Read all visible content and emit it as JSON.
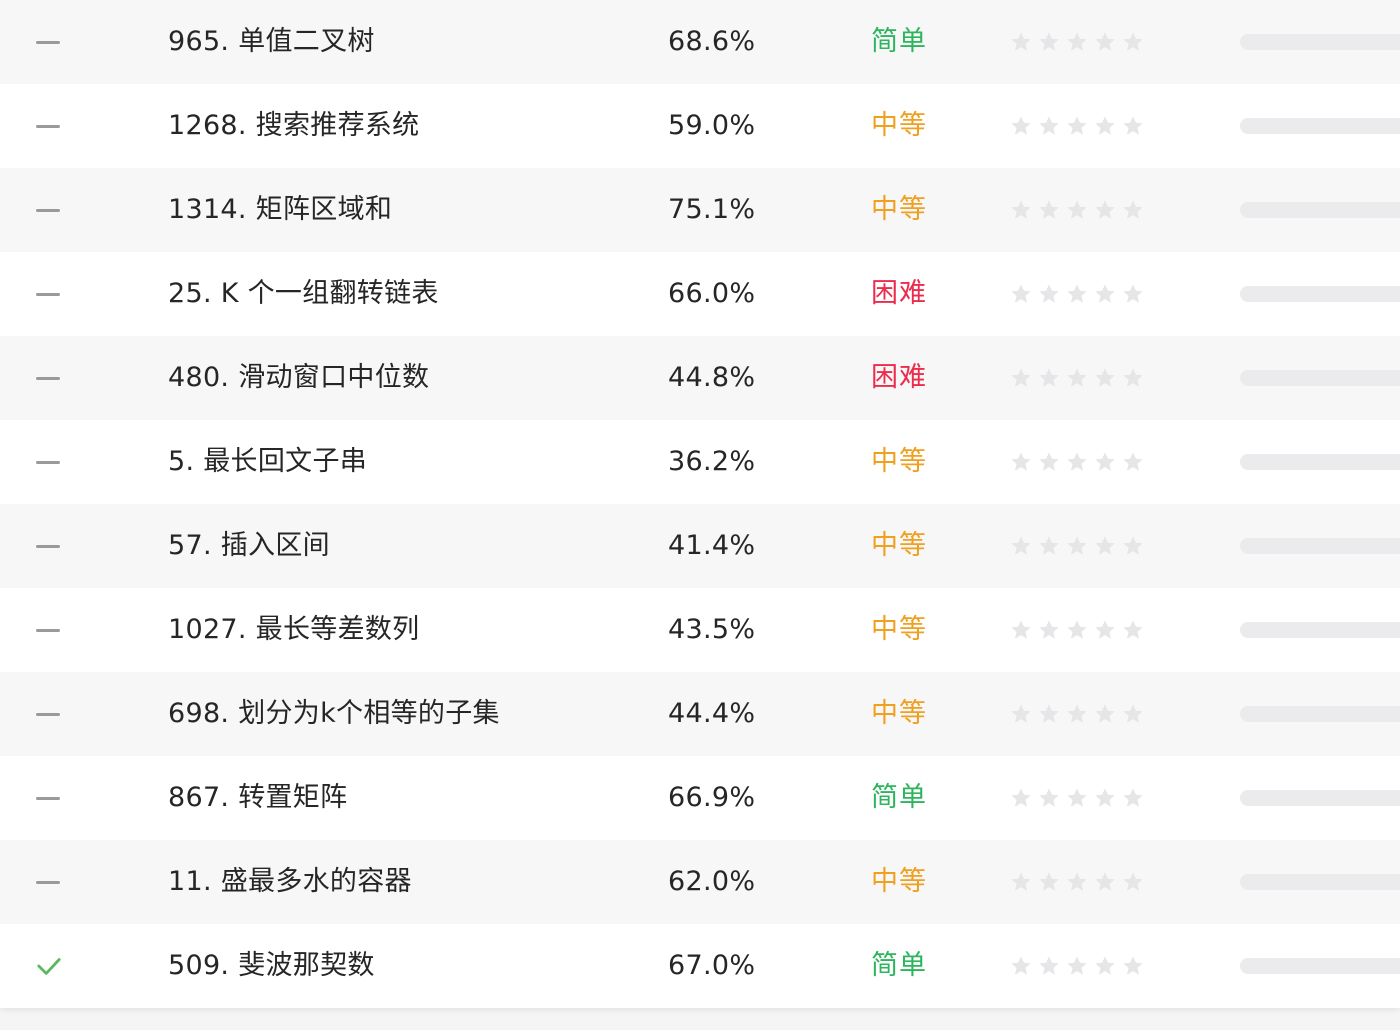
{
  "problems": [
    {
      "status": "none",
      "title": "965. 单值二叉树",
      "rate": "68.6%",
      "difficulty": "简单",
      "difficulty_color": "#2db55d",
      "frequency": 0
    },
    {
      "status": "none",
      "title": "1268. 搜索推荐系统",
      "rate": "59.0%",
      "difficulty": "中等",
      "difficulty_color": "#f0a020",
      "frequency": 0
    },
    {
      "status": "none",
      "title": "1314. 矩阵区域和",
      "rate": "75.1%",
      "difficulty": "中等",
      "difficulty_color": "#f0a020",
      "frequency": 0
    },
    {
      "status": "none",
      "title": "25. K 个一组翻转链表",
      "rate": "66.0%",
      "difficulty": "困难",
      "difficulty_color": "#ec2c4c",
      "frequency": 0
    },
    {
      "status": "none",
      "title": "480. 滑动窗口中位数",
      "rate": "44.8%",
      "difficulty": "困难",
      "difficulty_color": "#ec2c4c",
      "frequency": 0
    },
    {
      "status": "none",
      "title": "5. 最长回文子串",
      "rate": "36.2%",
      "difficulty": "中等",
      "difficulty_color": "#f0a020",
      "frequency": 0
    },
    {
      "status": "none",
      "title": "57. 插入区间",
      "rate": "41.4%",
      "difficulty": "中等",
      "difficulty_color": "#f0a020",
      "frequency": 0
    },
    {
      "status": "none",
      "title": "1027. 最长等差数列",
      "rate": "43.5%",
      "difficulty": "中等",
      "difficulty_color": "#f0a020",
      "frequency": 0
    },
    {
      "status": "none",
      "title": "698. 划分为k个相等的子集",
      "rate": "44.4%",
      "difficulty": "中等",
      "difficulty_color": "#f0a020",
      "frequency": 0
    },
    {
      "status": "none",
      "title": "867. 转置矩阵",
      "rate": "66.9%",
      "difficulty": "简单",
      "difficulty_color": "#2db55d",
      "frequency": 0
    },
    {
      "status": "none",
      "title": "11. 盛最多水的容器",
      "rate": "62.0%",
      "difficulty": "中等",
      "difficulty_color": "#f0a020",
      "frequency": 0
    },
    {
      "status": "solved",
      "title": "509. 斐波那契数",
      "rate": "67.0%",
      "difficulty": "简单",
      "difficulty_color": "#2db55d",
      "frequency": 0
    }
  ],
  "colors": {
    "solved_check": "#5cb85c",
    "dash": "#9a9a9a",
    "star_empty": "#e6e6e8"
  },
  "star_count": 5
}
